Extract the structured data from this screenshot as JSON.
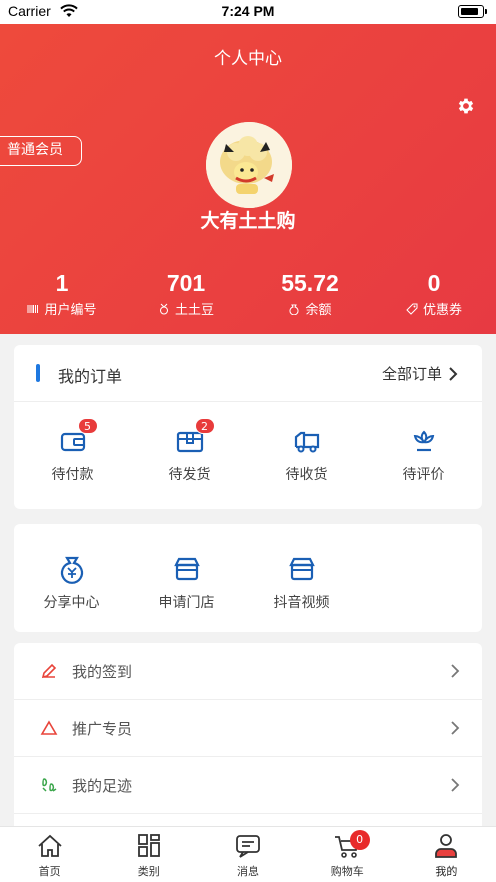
{
  "status_bar": {
    "carrier": "Carrier",
    "time": "7:24 PM"
  },
  "header": {
    "title": "个人中心",
    "member_level": "普通会员",
    "username": "大有土土购"
  },
  "stats": [
    {
      "value": "1",
      "label": "用户编号",
      "icon": "barcode-icon"
    },
    {
      "value": "701",
      "label": "土土豆",
      "icon": "medal-icon"
    },
    {
      "value": "55.72",
      "label": "余额",
      "icon": "money-bag-icon"
    },
    {
      "value": "0",
      "label": "优惠券",
      "icon": "coupon-icon"
    }
  ],
  "orders": {
    "title": "我的订单",
    "all_label": "全部订单",
    "items": [
      {
        "label": "待付款",
        "icon": "wallet-icon",
        "badge": "5"
      },
      {
        "label": "待发货",
        "icon": "package-icon",
        "badge": "2"
      },
      {
        "label": "待收货",
        "icon": "truck-icon",
        "badge": ""
      },
      {
        "label": "待评价",
        "icon": "flower-icon",
        "badge": ""
      }
    ]
  },
  "services": [
    {
      "label": "分享中心",
      "icon": "yuan-bag-icon"
    },
    {
      "label": "申请门店",
      "icon": "store-icon"
    },
    {
      "label": "抖音视频",
      "icon": "video-store-icon"
    }
  ],
  "menu": [
    {
      "label": "我的签到",
      "icon": "pencil-icon",
      "color": "#e8443a"
    },
    {
      "label": "推广专员",
      "icon": "triangle-icon",
      "color": "#e8443a"
    },
    {
      "label": "我的足迹",
      "icon": "footprint-icon",
      "color": "#3aa54a"
    }
  ],
  "tabbar": [
    {
      "label": "首页",
      "icon": "home-icon"
    },
    {
      "label": "类别",
      "icon": "category-icon"
    },
    {
      "label": "消息",
      "icon": "message-icon"
    },
    {
      "label": "购物车",
      "icon": "cart-icon",
      "badge": "0"
    },
    {
      "label": "我的",
      "icon": "profile-icon",
      "active": true
    }
  ],
  "colors": {
    "brand": "#e8403e",
    "accent_blue": "#1e78e0",
    "icon_blue": "#1a5fb4"
  }
}
